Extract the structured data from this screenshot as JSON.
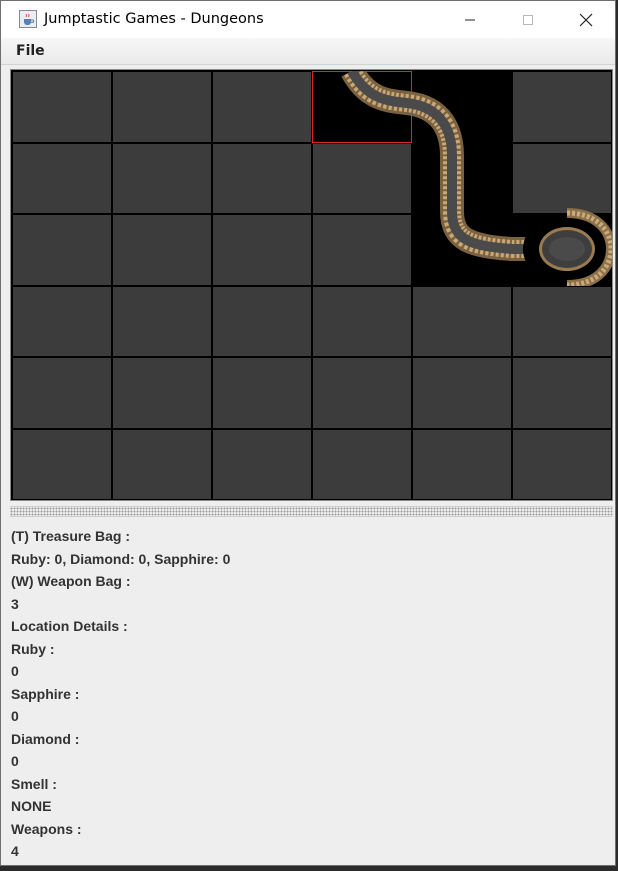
{
  "window": {
    "title": "Jumptastic Games - Dungeons",
    "app_icon": "java-cup-icon",
    "controls": [
      "minimize-icon",
      "maximize-icon",
      "close-icon"
    ]
  },
  "menu": {
    "items": [
      {
        "label": "File"
      }
    ]
  },
  "board": {
    "rows": 6,
    "columns": 6,
    "current_cell": {
      "row": 1,
      "column": 4
    },
    "explored_cells": [
      {
        "row": 1,
        "column": 4
      },
      {
        "row": 1,
        "column": 5
      },
      {
        "row": 2,
        "column": 5
      },
      {
        "row": 3,
        "column": 5
      },
      {
        "row": 3,
        "column": 6
      }
    ],
    "colors": {
      "unexplored": "#3c3c3c",
      "explored": "#000000",
      "grid_lines": "#000000",
      "current_highlight": "#e0242a"
    }
  },
  "status": {
    "treasure_bag_label": "(T) Treasure Bag :",
    "treasure_bag_value": "Ruby: 0, Diamond: 0, Sapphire: 0",
    "weapon_bag_label": "(W) Weapon Bag :",
    "weapon_bag_value": "3",
    "location_details_label": "Location Details :",
    "ruby_label": "Ruby :",
    "ruby_value": "0",
    "sapphire_label": "Sapphire :",
    "sapphire_value": "0",
    "diamond_label": "Diamond :",
    "diamond_value": "0",
    "smell_label": "Smell :",
    "smell_value": "NONE",
    "weapons_label": "Weapons :",
    "weapons_value": "4"
  }
}
